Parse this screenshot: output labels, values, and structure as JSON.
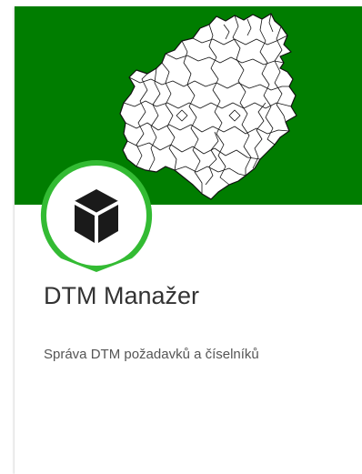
{
  "colors": {
    "banner_bg": "#007d00",
    "map_fill": "#ffffff",
    "map_stroke": "#111111",
    "pin_ring": "#33bb33",
    "pin_inner": "#ffffff",
    "icon": "#1a1a1a"
  },
  "card": {
    "title": "DTM Manažer",
    "description": "Správa DTM požadavků a číselníků",
    "banner_image": "region-map",
    "icon": "cube-icon"
  }
}
